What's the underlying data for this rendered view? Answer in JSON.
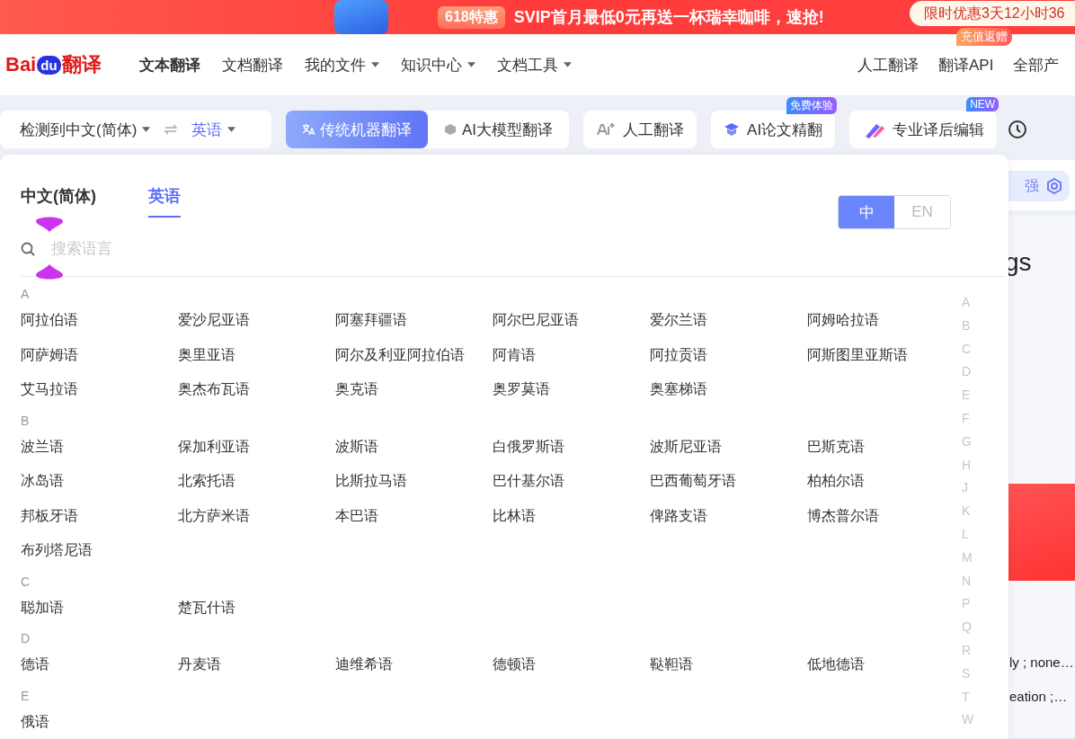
{
  "banner": {
    "badge": "618特惠",
    "text": "SVIP首月最低0元再送一杯瑞幸咖啡，速抢!",
    "promo": "限时优惠3天12小时36"
  },
  "nav": {
    "logo": {
      "part_1": "Bai",
      "part_2": "du",
      "part_3": "翻译"
    },
    "items": [
      {
        "label": "文本翻译",
        "selected": true,
        "dropdown": false
      },
      {
        "label": "文档翻译",
        "selected": false,
        "dropdown": false
      },
      {
        "label": "我的文件",
        "selected": false,
        "dropdown": true
      },
      {
        "label": "知识中心",
        "selected": false,
        "dropdown": true
      },
      {
        "label": "文档工具",
        "selected": false,
        "dropdown": true
      }
    ],
    "right_items": [
      {
        "label": "人工翻译"
      },
      {
        "label": "翻译API",
        "badge": "充值返赠"
      },
      {
        "label": "全部产"
      }
    ]
  },
  "toolbar": {
    "source": "检测到中文(简体)",
    "target": "英语",
    "modes": [
      {
        "label": "传统机器翻译",
        "selected": true
      },
      {
        "label": "AI大模型翻译",
        "selected": false
      }
    ],
    "buttons": [
      {
        "kind": "human",
        "label": "人工翻译"
      },
      {
        "kind": "paper",
        "label": "AI论文精翻",
        "badge": "免费体验"
      },
      {
        "kind": "edit",
        "label": "专业译后编辑",
        "badge": "NEW"
      }
    ]
  },
  "background": {
    "chip": "强",
    "heading": "gs",
    "line_1": "ly ; none…",
    "line_2": "eation ;…"
  },
  "panel": {
    "tabs": [
      {
        "label": "中文(简体)",
        "selected": false
      },
      {
        "label": "英语",
        "selected": true
      }
    ],
    "script_toggle": [
      {
        "label": "中",
        "selected": true
      },
      {
        "label": "EN",
        "selected": false
      }
    ],
    "search": {
      "placeholder": "搜索语言"
    },
    "groups": [
      {
        "letter": "A",
        "languages": [
          "阿拉伯语",
          "爱沙尼亚语",
          "阿塞拜疆语",
          "阿尔巴尼亚语",
          "爱尔兰语",
          "阿姆哈拉语",
          "阿萨姆语",
          "奥里亚语",
          "阿尔及利亚阿拉伯语",
          "阿肯语",
          "阿拉贡语",
          "阿斯图里亚斯语",
          "艾马拉语",
          "奥杰布瓦语",
          "奥克语",
          "奥罗莫语",
          "奥塞梯语"
        ]
      },
      {
        "letter": "B",
        "languages": [
          "波兰语",
          "保加利亚语",
          "波斯语",
          "白俄罗斯语",
          "波斯尼亚语",
          "巴斯克语",
          "冰岛语",
          "北索托语",
          "比斯拉马语",
          "巴什基尔语",
          "巴西葡萄牙语",
          "柏柏尔语",
          "邦板牙语",
          "北方萨米语",
          "本巴语",
          "比林语",
          "俾路支语",
          "博杰普尔语",
          "布列塔尼语"
        ]
      },
      {
        "letter": "C",
        "languages": [
          "聪加语",
          "楚瓦什语"
        ]
      },
      {
        "letter": "D",
        "languages": [
          "德语",
          "丹麦语",
          "迪维希语",
          "德顿语",
          "鞑靼语",
          "低地德语"
        ]
      },
      {
        "letter": "E",
        "languages": [
          "俄语"
        ]
      }
    ],
    "index": [
      "A",
      "B",
      "C",
      "D",
      "E",
      "F",
      "G",
      "H",
      "J",
      "K",
      "L",
      "M",
      "N",
      "P",
      "Q",
      "R",
      "S",
      "T",
      "W"
    ]
  }
}
